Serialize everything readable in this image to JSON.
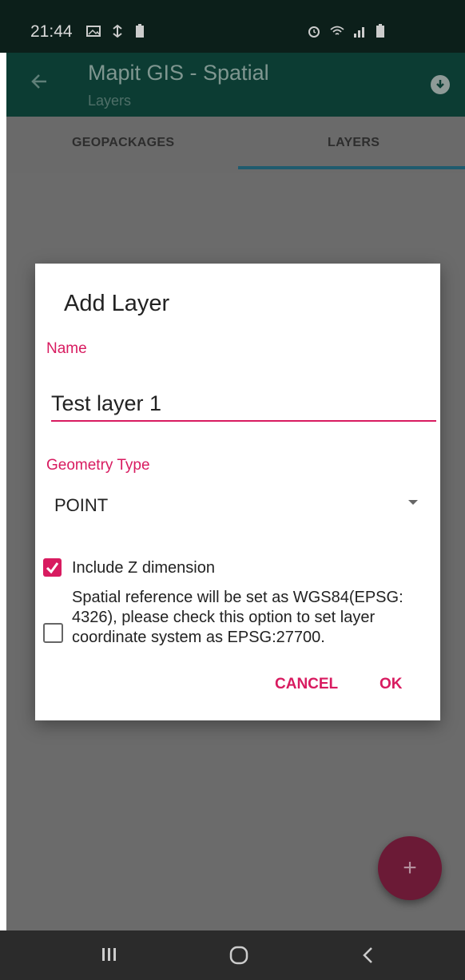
{
  "status_bar": {
    "time": "21:44",
    "left_icons": [
      "image-icon",
      "sync-icon",
      "battery-icon"
    ],
    "right_icons": [
      "alarm-icon",
      "wifi-icon",
      "signal-icon",
      "battery-icon"
    ]
  },
  "app_bar": {
    "title": "Mapit GIS - Spatial",
    "subtitle": "Layers",
    "back_icon": "arrow-left-icon",
    "action_icon": "download-icon"
  },
  "tabs": [
    {
      "label": "GEOPACKAGES",
      "selected": false
    },
    {
      "label": "LAYERS",
      "selected": true
    }
  ],
  "dialog": {
    "title": "Add Layer",
    "name_label": "Name",
    "name_value": "Test layer 1",
    "geometry_label": "Geometry Type",
    "geometry_value": "POINT",
    "include_z_label": "Include Z dimension",
    "include_z_checked": true,
    "spatial_ref_text": "Spatial reference will be set as WGS84(EPSG: 4326), please check this option to set layer coordinate system as EPSG:27700.",
    "spatial_ref_checked": false,
    "cancel_label": "CANCEL",
    "ok_label": "OK"
  },
  "fab": {
    "label": "+"
  },
  "nav_bar": {
    "icons": [
      "recent-apps-icon",
      "home-icon",
      "back-icon"
    ]
  },
  "colors": {
    "accent": "#d81b60",
    "primary_dark": "#0c3c33",
    "status_bar": "#0c1f1a"
  }
}
